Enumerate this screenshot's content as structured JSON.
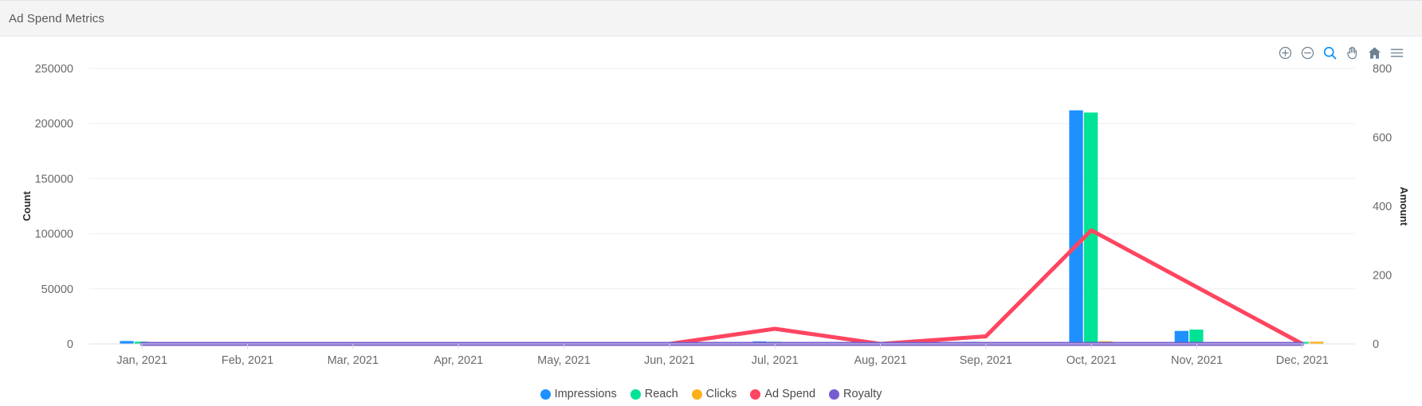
{
  "header": {
    "title": "Ad Spend Metrics"
  },
  "toolbar": {
    "buttons": [
      {
        "name": "zoom-in-icon",
        "label": "Zoom In",
        "active": false
      },
      {
        "name": "zoom-out-icon",
        "label": "Zoom Out",
        "active": false
      },
      {
        "name": "zoom-selection-icon",
        "label": "Selection Zoom",
        "active": true
      },
      {
        "name": "pan-icon",
        "label": "Panning",
        "active": false
      },
      {
        "name": "home-icon",
        "label": "Reset Zoom",
        "active": false
      },
      {
        "name": "menu-icon",
        "label": "Menu",
        "active": false
      }
    ],
    "active_color": "#008ffb",
    "idle_color": "#6e8192"
  },
  "chart_data": {
    "type": "bar",
    "title": "Ad Spend Metrics",
    "xlabel": "",
    "ylabel": "Count",
    "y2label": "Amount",
    "grid": true,
    "legend_position": "bottom",
    "categories": [
      "Jan, 2021",
      "Feb, 2021",
      "Mar, 2021",
      "Apr, 2021",
      "May, 2021",
      "Jun, 2021",
      "Jul, 2021",
      "Aug, 2021",
      "Sep, 2021",
      "Oct, 2021",
      "Nov, 2021",
      "Dec, 2021"
    ],
    "ylim": [
      0,
      250000
    ],
    "yticks": [
      0,
      50000,
      100000,
      150000,
      200000,
      250000
    ],
    "ytick_labels": [
      "0",
      "50000",
      "100000",
      "150000",
      "200000",
      "250000"
    ],
    "y2lim": [
      0,
      800
    ],
    "y2ticks": [
      0,
      200,
      400,
      600,
      800
    ],
    "y2tick_labels": [
      "0",
      "200",
      "400",
      "600",
      "800"
    ],
    "series": [
      {
        "name": "Impressions",
        "type": "bar",
        "axis": "left",
        "color": "#1e90ff",
        "values": [
          2600,
          0,
          0,
          0,
          0,
          0,
          2300,
          0,
          1900,
          212000,
          11800,
          0
        ]
      },
      {
        "name": "Reach",
        "type": "bar",
        "axis": "left",
        "color": "#00e396",
        "values": [
          2100,
          0,
          0,
          0,
          0,
          0,
          2000,
          0,
          1700,
          210000,
          13000,
          1200
        ]
      },
      {
        "name": "Clicks",
        "type": "bar",
        "axis": "left",
        "color": "#feb019",
        "values": [
          0,
          0,
          0,
          0,
          0,
          0,
          900,
          0,
          800,
          2400,
          1100,
          2000
        ]
      },
      {
        "name": "Ad Spend",
        "type": "line",
        "axis": "right",
        "color": "#ff4560",
        "values": [
          0,
          0,
          0,
          0,
          0,
          0,
          44,
          0,
          22,
          330,
          165,
          0
        ]
      },
      {
        "name": "Royalty",
        "type": "line",
        "axis": "right",
        "color": "#775dd0",
        "values": [
          0,
          0,
          0,
          0,
          0,
          0,
          0,
          0,
          0,
          0,
          0,
          0
        ]
      }
    ]
  }
}
